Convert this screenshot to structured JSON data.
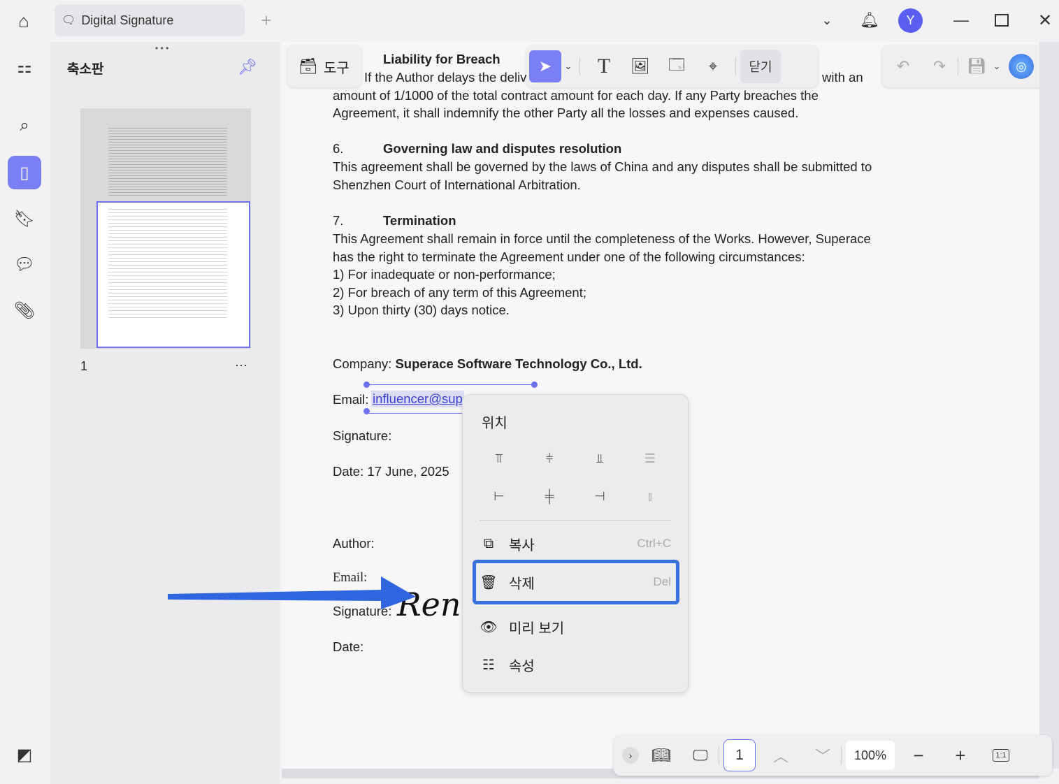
{
  "window": {
    "tab_title": "Digital Signature",
    "avatar_letter": "Y",
    "accent": "#7b7ff5"
  },
  "sidebar": {
    "panel_title": "축소판",
    "page_label": "1",
    "more": "···"
  },
  "toolbar": {
    "tools_label": "도구",
    "close_label": "닫기"
  },
  "document": {
    "s5_heading": "Liability for Breach",
    "s5_line1": "If the Author delays the delivery",
    "s5_line1_end": "with an",
    "s5_line2": "amount of 1/1000 of the total contract amount for each day. If any Party breaches the",
    "s5_line3": "Agreement, it shall indemnify the other Party all the losses and expenses caused.",
    "s6_num": "6.",
    "s6_heading": "Governing law and disputes resolution",
    "s6_line1": "This agreement shall be governed by the laws of China and any disputes shall be submitted to",
    "s6_line2": "Shenzhen Court of International Arbitration.",
    "s7_num": "7.",
    "s7_heading": "Termination",
    "s7_line1": "This Agreement shall remain in force until the completeness of the Works. However, Superace",
    "s7_line2": "has the right to terminate the Agreement under one of the following circumstances:",
    "s7_item1": "1) For inadequate or non-performance;",
    "s7_item2": "2) For breach of any term of this Agreement;",
    "s7_item3": "3)  Upon thirty (30) days notice.",
    "company_label": "Company: ",
    "company_value": "Superace Software Technology Co., Ltd.",
    "email_label": "Email:",
    "email_value": "influencer@sup",
    "signature_label": "Signature:",
    "date_label": "Date: 17 June, 2025",
    "author_label": "Author:",
    "author_email_label": "Email:",
    "author_signature_label": "Signature:",
    "author_signature_value": "Rene",
    "author_date_label": "Date:"
  },
  "context_menu": {
    "section_title": "위치",
    "items": [
      {
        "label": "복사",
        "shortcut": "Ctrl+C",
        "icon": "copy-icon"
      },
      {
        "label": "삭제",
        "shortcut": "Del",
        "icon": "trash-icon",
        "highlighted": true
      },
      {
        "label": "미리 보기",
        "icon": "preview-icon"
      },
      {
        "label": "속성",
        "icon": "properties-icon"
      }
    ]
  },
  "bottom_toolbar": {
    "page_number": "1",
    "zoom": "100%",
    "fit_label": "1:1"
  },
  "annotation_arrow_color": "#2f66e0",
  "highlight_color": "#3a6fe0"
}
